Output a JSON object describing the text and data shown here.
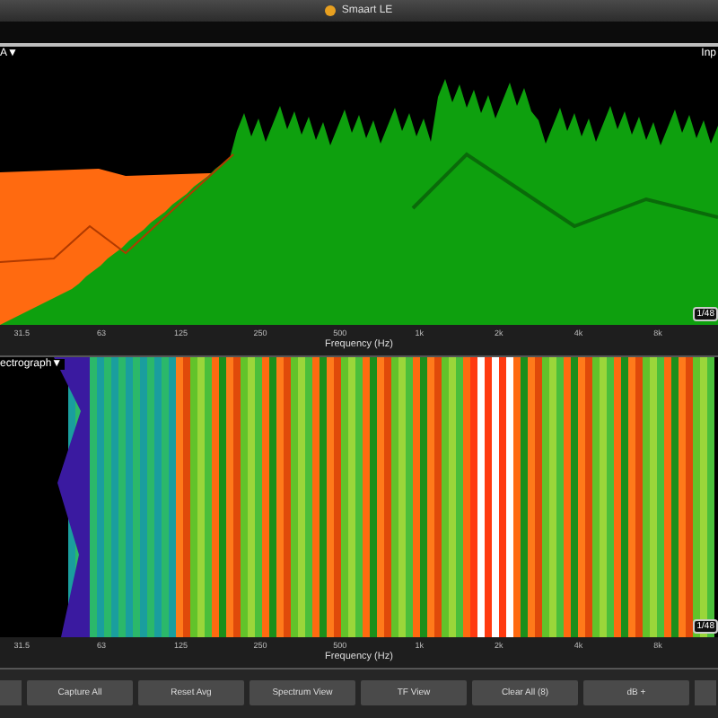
{
  "window": {
    "title": "Smaart LE"
  },
  "rta": {
    "label": "A▼",
    "right_label": "Inp",
    "badge": "1/48",
    "axis": {
      "ticks": [
        "31.5",
        "63",
        "125",
        "250",
        "500",
        "1k",
        "2k",
        "4k",
        "8k"
      ],
      "label": "Frequency (Hz)"
    }
  },
  "spectrograph": {
    "label": "ectrograph▼",
    "badge": "1/48",
    "axis": {
      "ticks": [
        "31.5",
        "63",
        "125",
        "250",
        "500",
        "1k",
        "2k",
        "4k",
        "8k"
      ],
      "label": "Frequency (Hz)"
    }
  },
  "buttons": [
    "Capture All",
    "Reset Avg",
    "Spectrum View",
    "TF View",
    "Clear All (8)",
    "dB +"
  ]
}
